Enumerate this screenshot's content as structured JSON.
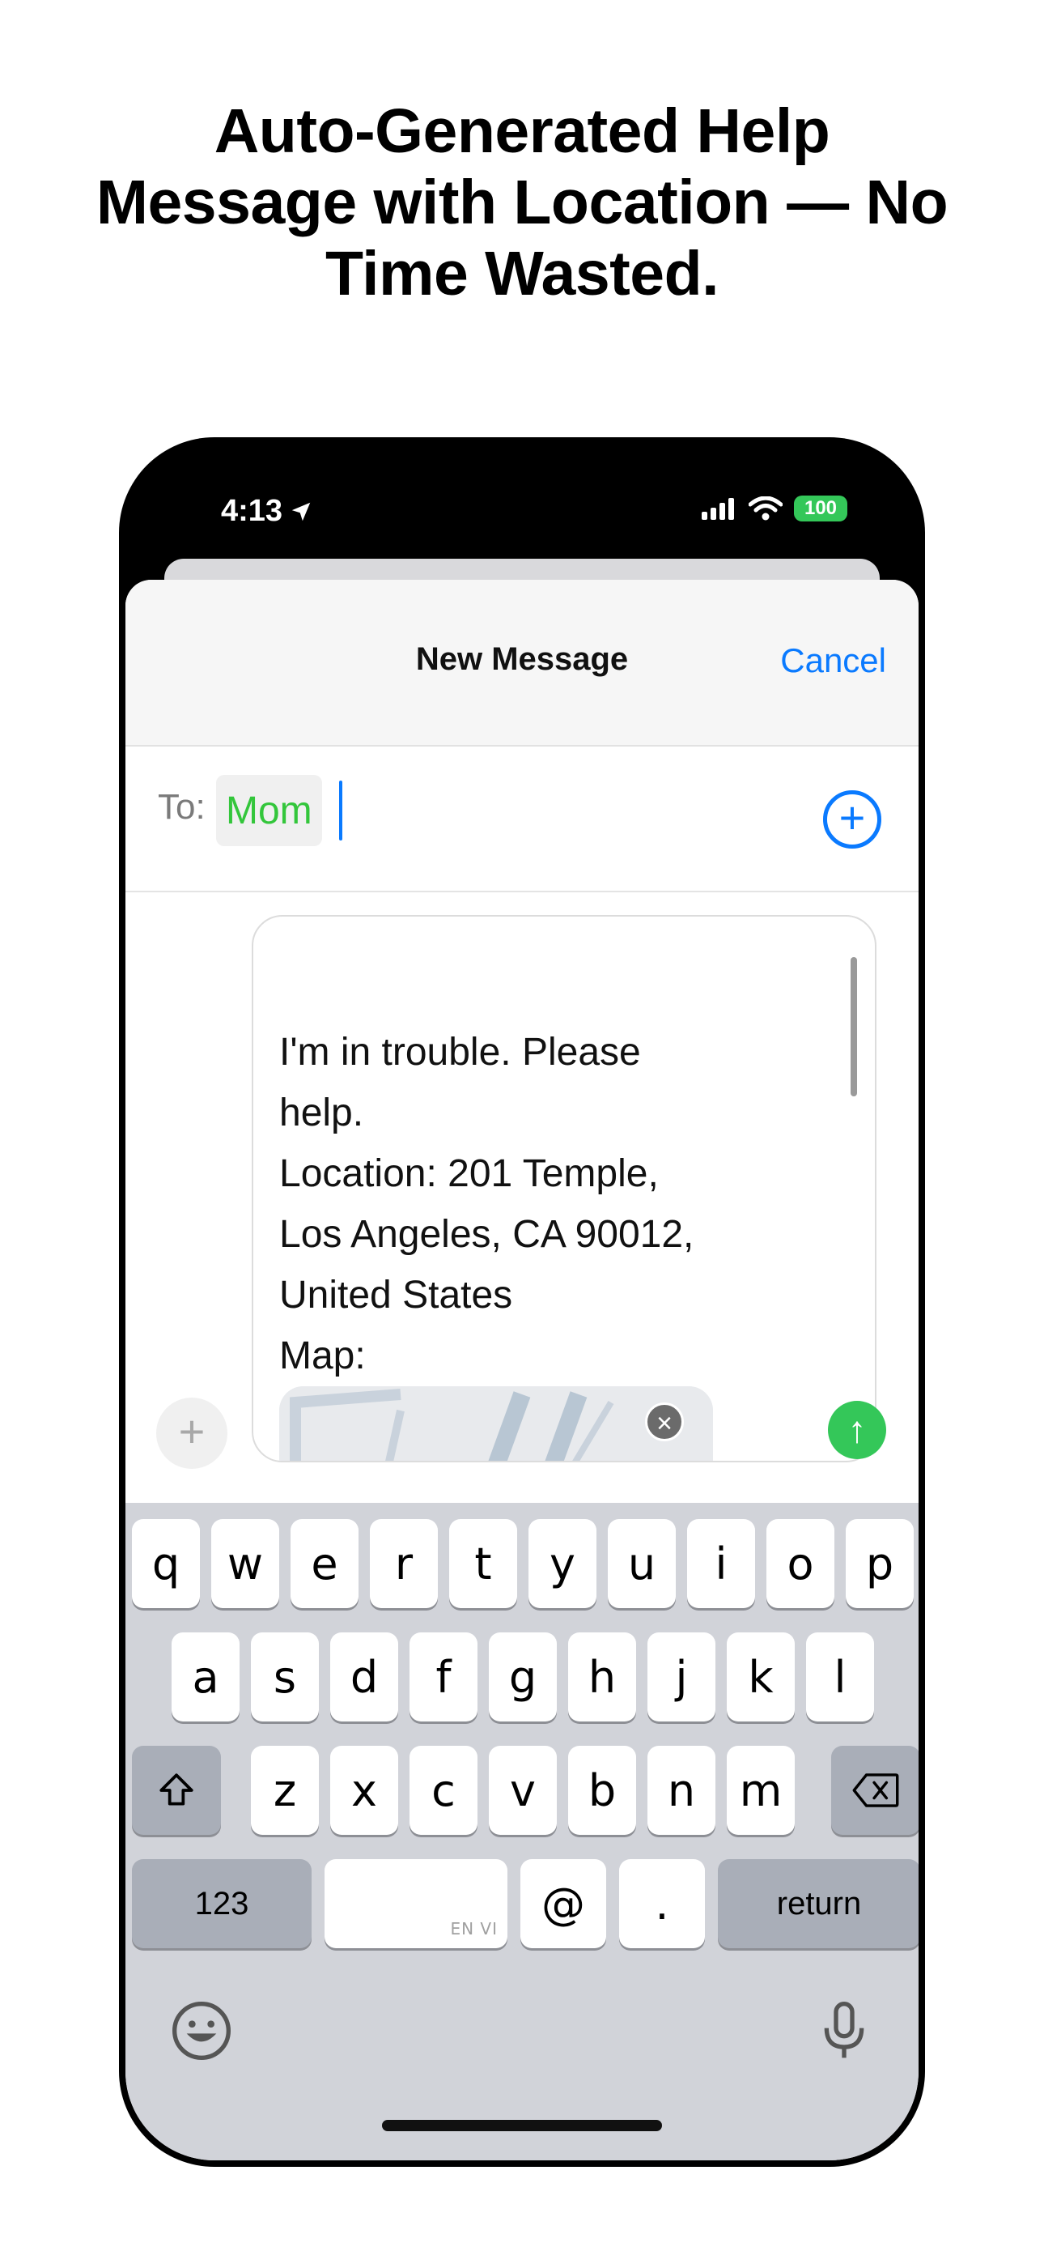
{
  "headline": {
    "line1": "Auto-Generated Help",
    "line2": "Message with Location — No",
    "line3": "Time Wasted."
  },
  "status_bar": {
    "time": "4:13",
    "battery": "100"
  },
  "compose_sheet": {
    "title": "New Message",
    "cancel_label": "Cancel",
    "to_label": "To:",
    "recipient": "Mom",
    "message_lines": [
      "I'm in trouble. Please",
      "help.",
      "Location: 201 Temple,",
      "Los Angeles, CA 90012,",
      "United States",
      "Map:"
    ]
  },
  "keyboard": {
    "row1": [
      "q",
      "w",
      "e",
      "r",
      "t",
      "y",
      "u",
      "i",
      "o",
      "p"
    ],
    "row2": [
      "a",
      "s",
      "d",
      "f",
      "g",
      "h",
      "j",
      "k",
      "l"
    ],
    "row3": [
      "z",
      "x",
      "c",
      "v",
      "b",
      "n",
      "m"
    ],
    "numbers_label": "123",
    "space_hint": "EN VI",
    "at_label": "@",
    "dot_label": ".",
    "return_label": "return"
  },
  "colors": {
    "accent_blue": "#0a7aff",
    "recipient_green": "#33c63b",
    "send_green": "#34c759",
    "keyboard_bg": "#d1d3d9"
  },
  "icons": [
    "location-arrow-icon",
    "signal-icon",
    "wifi-icon",
    "battery-icon",
    "add-recipient-icon",
    "attach-plus-icon",
    "remove-attachment-icon",
    "send-arrow-icon",
    "shift-icon",
    "delete-icon",
    "emoji-icon",
    "microphone-icon"
  ]
}
